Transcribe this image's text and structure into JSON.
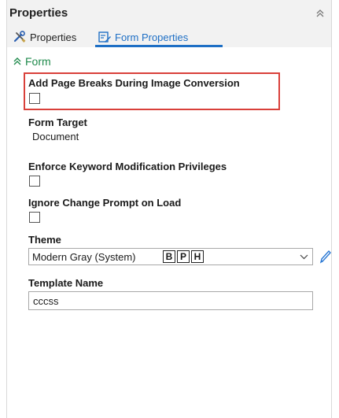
{
  "panel": {
    "title": "Properties",
    "collapse_icon": "double-chevron-up-icon"
  },
  "tabs": [
    {
      "label": "Properties",
      "icon": "tools-icon",
      "active": false
    },
    {
      "label": "Form Properties",
      "icon": "form-properties-icon",
      "active": true
    }
  ],
  "section": {
    "label": "Form",
    "icon": "double-chevron-up-icon",
    "color": "#1f8a4c"
  },
  "fields": {
    "page_breaks": {
      "label": "Add Page Breaks During Image Conversion",
      "checked": false
    },
    "form_target": {
      "label": "Form Target",
      "value": "Document"
    },
    "enforce_keyword": {
      "label": "Enforce Keyword Modification Privileges",
      "checked": false
    },
    "ignore_change": {
      "label": "Ignore Change Prompt on Load",
      "checked": false
    },
    "theme": {
      "label": "Theme",
      "selected": "Modern Gray (System)",
      "badges": [
        "B",
        "P",
        "H"
      ],
      "edit_icon": "pencil-icon"
    },
    "template_name": {
      "label": "Template Name",
      "value": "cccss"
    }
  },
  "colors": {
    "accent": "#1e6fc5",
    "highlight_border": "#d9403a",
    "section_green": "#1f8a4c"
  }
}
